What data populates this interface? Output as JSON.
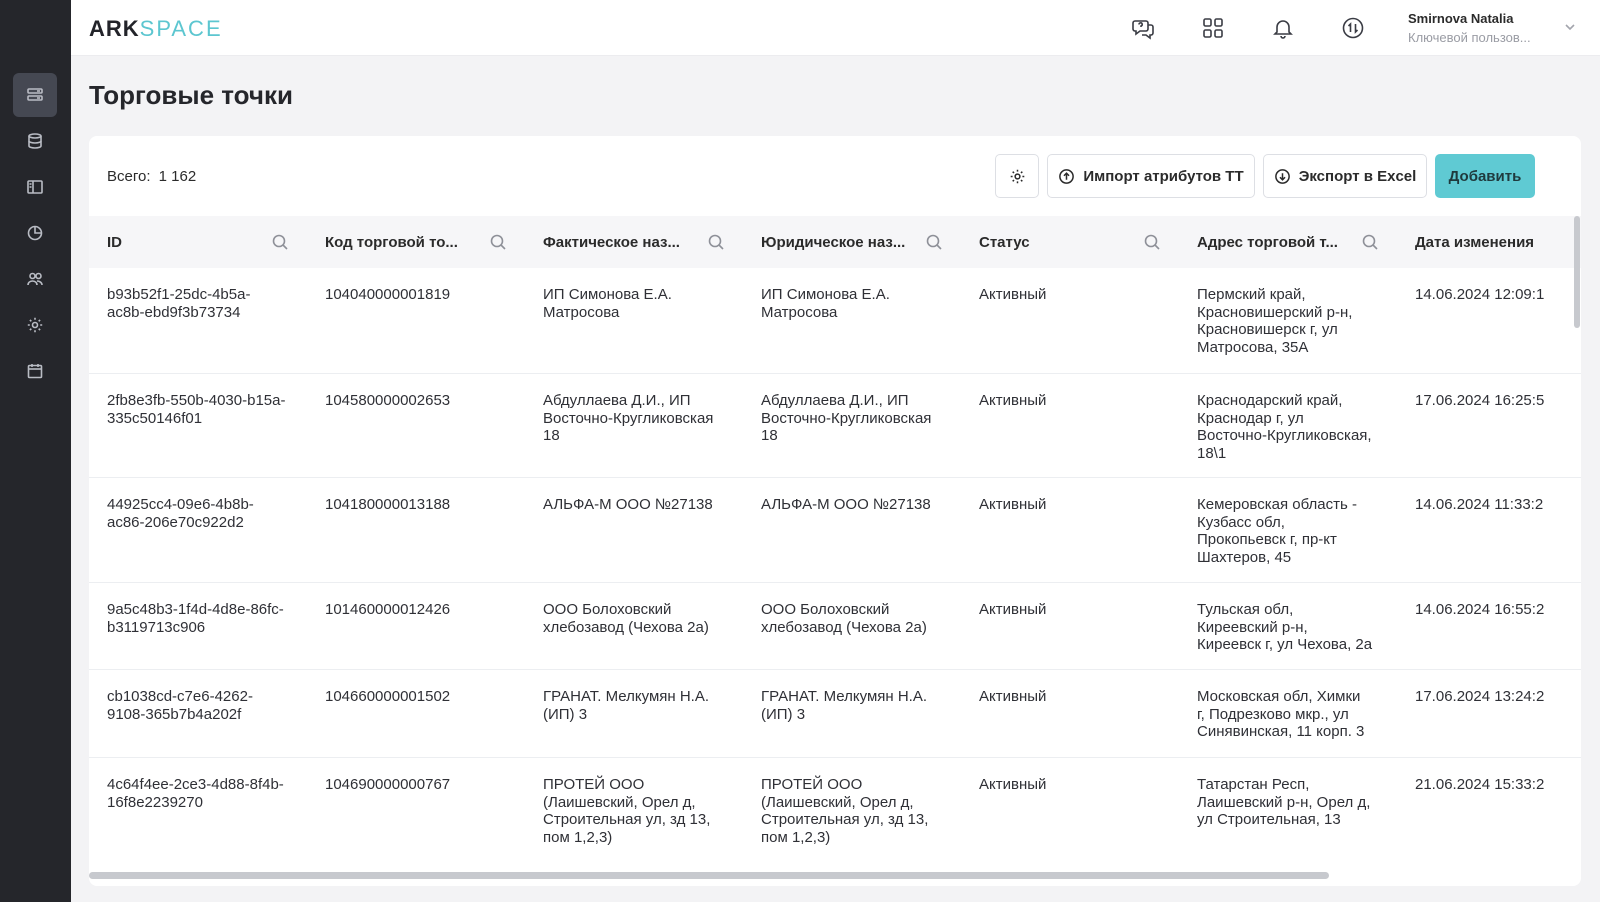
{
  "app": {
    "logo_ark": "ARK",
    "logo_space": "SPACE"
  },
  "sidebar": {
    "items": [
      {
        "name": "sidebar-item-outlets",
        "icon": "list-icon"
      },
      {
        "name": "sidebar-item-database",
        "icon": "database-icon"
      },
      {
        "name": "sidebar-item-catalog",
        "icon": "catalog-icon"
      },
      {
        "name": "sidebar-item-reports",
        "icon": "pie-chart-icon"
      },
      {
        "name": "sidebar-item-users",
        "icon": "users-icon"
      },
      {
        "name": "sidebar-item-settings",
        "icon": "gear-icon"
      },
      {
        "name": "sidebar-item-calendar",
        "icon": "calendar-icon"
      }
    ]
  },
  "header": {
    "user_name": "Smirnova Natalia",
    "user_role": "Ключевой пользов..."
  },
  "page": {
    "title": "Торговые точки"
  },
  "toolbar": {
    "total_label": "Всего:",
    "total_value": "1 162",
    "import_label": "Импорт атрибутов ТТ",
    "export_label": "Экспорт в Excel",
    "add_label": "Добавить"
  },
  "table": {
    "columns": [
      "ID",
      "Код торговой то...",
      "Фактическое наз...",
      "Юридическое наз...",
      "Статус",
      "Адрес торговой т...",
      "Дата изменения"
    ],
    "rows": [
      {
        "id": "b93b52f1-25dc-4b5a-\nac8b-ebd9f3b73734",
        "code": "104040000001819",
        "actual": "ИП Симонова Е.А.\nМатросова",
        "legal": "ИП Симонова Е.А.\nМатросова",
        "status": "Активный",
        "address": "Пермский край,\nКрасновишерский р-н,\nКрасновишерск г, ул\nМатросова, 35А",
        "date": "14.06.2024 12:09:1"
      },
      {
        "id": "2fb8e3fb-550b-4030-b15a-\n335c50146f01",
        "code": "104580000002653",
        "actual": "Абдуллаева Д.И., ИП\nВосточно-Кругликовская\n18",
        "legal": "Абдуллаева Д.И., ИП\nВосточно-Кругликовская\n18",
        "status": "Активный",
        "address": "Краснодарский край,\nКраснодар г, ул\nВосточно-Кругликовская,\n18\\1",
        "date": "17.06.2024 16:25:5"
      },
      {
        "id": "44925cc4-09e6-4b8b-\nac86-206e70c922d2",
        "code": "104180000013188",
        "actual": "АЛЬФА-М ООО №27138",
        "legal": "АЛЬФА-М ООО №27138",
        "status": "Активный",
        "address": "Кемеровская область -\nКузбасс обл,\nПрокопьевск г, пр-кт\nШахтеров, 45",
        "date": "14.06.2024 11:33:2"
      },
      {
        "id": "9a5c48b3-1f4d-4d8e-86fc-\nb3119713c906",
        "code": "101460000012426",
        "actual": "ООО Болоховский\nхлебозавод (Чехова 2а)",
        "legal": "ООО Болоховский\nхлебозавод (Чехова 2а)",
        "status": "Активный",
        "address": "Тульская обл,\nКиреевский р-н,\nКиреевск г, ул Чехова, 2а",
        "date": "14.06.2024 16:55:2"
      },
      {
        "id": "cb1038cd-c7e6-4262-\n9108-365b7b4a202f",
        "code": "104660000001502",
        "actual": "ГРАНАТ. Мелкумян Н.А.\n(ИП) 3",
        "legal": "ГРАНАТ. Мелкумян Н.А.\n(ИП) 3",
        "status": "Активный",
        "address": "Московская обл, Химки\nг, Подрезково мкр., ул\nСинявинская, 11 корп. 3",
        "date": "17.06.2024 13:24:2"
      },
      {
        "id": "4c64f4ee-2ce3-4d88-8f4b-\n16f8e2239270",
        "code": "104690000000767",
        "actual": "ПРОТЕЙ ООО\n(Лаишевский, Орел д,\nСтроительная ул, зд 13,\nпом 1,2,3)",
        "legal": "ПРОТЕЙ ООО\n(Лаишевский, Орел д,\nСтроительная ул, зд 13,\nпом 1,2,3)",
        "status": "Активный",
        "address": "Татарстан Респ,\nЛаишевский р-н, Орел д,\nул Строительная, 13",
        "date": "21.06.2024 15:33:2"
      }
    ]
  }
}
